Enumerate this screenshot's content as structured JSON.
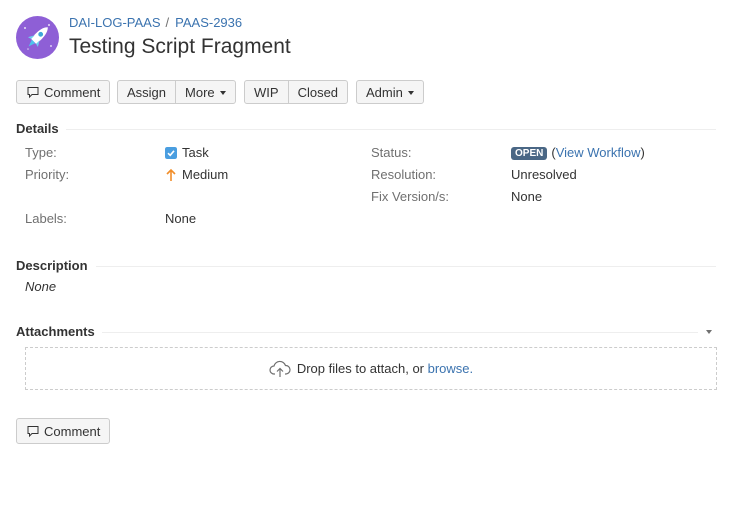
{
  "header": {
    "project": "DAI-LOG-PAAS",
    "separator": "/",
    "issue_key": "PAAS-2936",
    "title": "Testing Script Fragment",
    "avatar_icon": "rocket-icon",
    "avatar_color": "#8e5fd6"
  },
  "toolbar": {
    "comment_label": "Comment",
    "assign_label": "Assign",
    "more_label": "More",
    "wip_label": "WIP",
    "closed_label": "Closed",
    "admin_label": "Admin"
  },
  "details": {
    "heading": "Details",
    "type_label": "Type:",
    "type_value": "Task",
    "priority_label": "Priority:",
    "priority_value": "Medium",
    "labels_label": "Labels:",
    "labels_value": "None",
    "status_label": "Status:",
    "status_value": "OPEN",
    "status_open_paren": "(",
    "view_workflow": "View Workflow",
    "status_close_paren": ")",
    "resolution_label": "Resolution:",
    "resolution_value": "Unresolved",
    "fix_version_label": "Fix Version/s:",
    "fix_version_value": "None",
    "status_color": "#4a6785",
    "priority_color": "#f18e2a",
    "task_color": "#4a9ee0"
  },
  "description": {
    "heading": "Description",
    "value": "None"
  },
  "attachments": {
    "heading": "Attachments",
    "drop_text": "Drop files to attach, or",
    "browse_label": "browse.",
    "drop_icon": "cloud-upload-icon"
  },
  "footer": {
    "comment_label": "Comment"
  },
  "colors": {
    "link": "#3b73af",
    "label": "#707070",
    "text": "#333333"
  }
}
